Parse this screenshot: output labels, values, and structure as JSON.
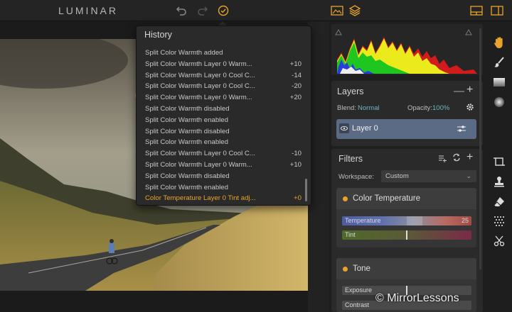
{
  "app": {
    "name": "LUMINAR"
  },
  "icons": {
    "undo": "undo-icon",
    "redo": "redo-icon",
    "history": "history-check-icon",
    "compare": "image-compare-icon",
    "layers": "layers-stack-icon",
    "layout": "layout-panel-icon",
    "fullscreen": "fullscreen-icon"
  },
  "colors": {
    "accent": "#e8a32b",
    "blend_accent": "#6fb5c2",
    "layer_selected": "#5b6a85"
  },
  "history": {
    "title": "History",
    "items": [
      {
        "label": "Split Color Warmth added",
        "value": ""
      },
      {
        "label": "Split Color Warmth Layer 0 Warm...",
        "value": "+10"
      },
      {
        "label": "Split Color Warmth Layer 0 Cool C...",
        "value": "-14"
      },
      {
        "label": "Split Color Warmth Layer 0 Cool C...",
        "value": "-20"
      },
      {
        "label": "Split Color Warmth Layer 0 Warm...",
        "value": "+20"
      },
      {
        "label": "Split Color Warmth disabled",
        "value": ""
      },
      {
        "label": "Split Color Warmth enabled",
        "value": ""
      },
      {
        "label": "Split Color Warmth disabled",
        "value": ""
      },
      {
        "label": "Split Color Warmth enabled",
        "value": ""
      },
      {
        "label": "Split Color Warmth Layer 0 Cool C...",
        "value": "-10"
      },
      {
        "label": "Split Color Warmth Layer 0 Warm...",
        "value": "+10"
      },
      {
        "label": "Split Color Warmth disabled",
        "value": ""
      },
      {
        "label": "Split Color Warmth enabled",
        "value": ""
      },
      {
        "label": "Color Temperature Layer 0 Tint adj...",
        "value": "+0"
      }
    ],
    "active_index": 13
  },
  "layers": {
    "title": "Layers",
    "blend_label": "Blend:",
    "blend_value": "Normal",
    "opacity_label": "Opacity:",
    "opacity_value": "100%",
    "layer_name": "Layer 0"
  },
  "filters": {
    "title": "Filters",
    "workspace_label": "Workspace:",
    "workspace_value": "Custom",
    "color_temperature": {
      "title": "Color Temperature",
      "temperature_label": "Temperature",
      "temperature_value": "25",
      "temperature_fraction": 0.625,
      "tint_label": "Tint",
      "tint_fraction": 0.5
    },
    "tone": {
      "title": "Tone",
      "exposure_label": "Exposure",
      "exposure_fraction": 0.5,
      "contrast_label": "Contrast"
    }
  },
  "tools": [
    "hand-tool-icon",
    "brush-tool-icon",
    "gradient-tool-icon",
    "radial-tool-icon",
    "crop-tool-icon",
    "stamp-tool-icon",
    "eraser-tool-icon",
    "noise-tool-icon",
    "scissors-tool-icon"
  ],
  "watermark": "© MirrorLessons"
}
